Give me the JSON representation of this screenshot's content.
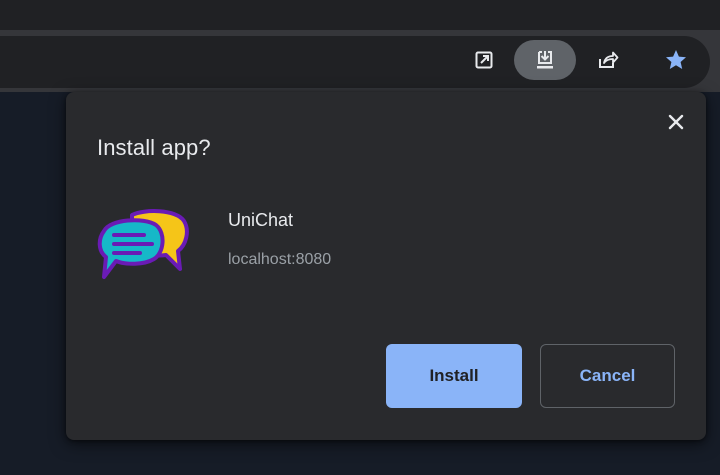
{
  "toolbar": {
    "icons": [
      "open-in-app-icon",
      "install-app-icon",
      "share-icon",
      "bookmark-star-icon"
    ]
  },
  "dialog": {
    "title": "Install app?",
    "close_icon": "close-icon",
    "app": {
      "name": "UniChat",
      "origin": "localhost:8080",
      "icon": "chat-bubbles-icon"
    },
    "install_label": "Install",
    "cancel_label": "Cancel"
  },
  "colors": {
    "accent": "#8ab4f8",
    "dialog_bg": "#292a2d",
    "text_primary": "#e8eaed",
    "text_secondary": "#9aa0a6",
    "star": "#8ab4f8",
    "icon_bubble_front": "#16b8c8",
    "icon_bubble_back": "#f5c518",
    "icon_outline": "#6a1bb5"
  }
}
